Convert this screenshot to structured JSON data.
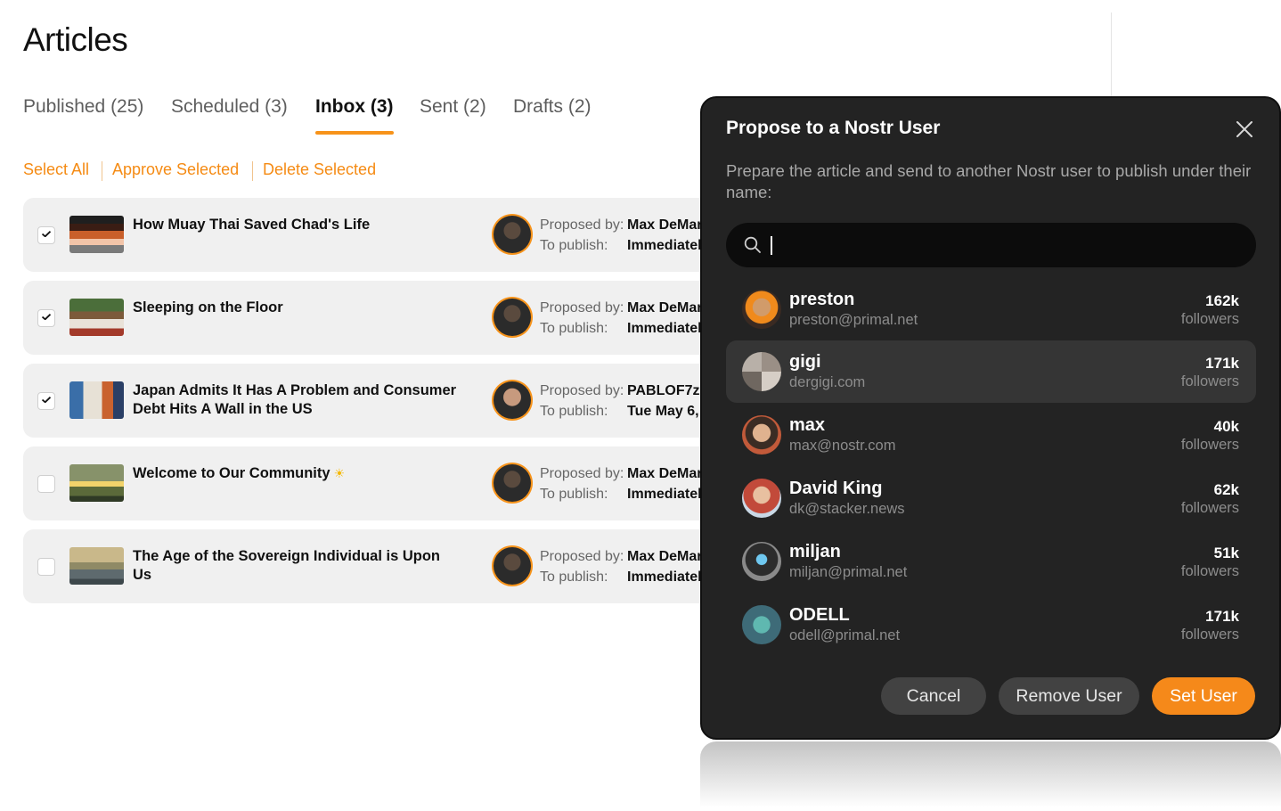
{
  "page": {
    "title": "Articles"
  },
  "tabs": [
    {
      "label": "Published (25)",
      "active": false
    },
    {
      "label": "Scheduled (3)",
      "active": false
    },
    {
      "label": "Inbox (3)",
      "active": true
    },
    {
      "label": "Sent (2)",
      "active": false
    },
    {
      "label": "Drafts (2)",
      "active": false
    }
  ],
  "bulk_actions": {
    "select_all": "Select All",
    "approve": "Approve Selected",
    "delete": "Delete Selected"
  },
  "articles": [
    {
      "title": "How Muay Thai Saved Chad's Life",
      "checked": true,
      "proposed_label": "Proposed by:",
      "proposed_by": "Max DeMar",
      "publish_label": "To publish:",
      "publish": "Immediatel"
    },
    {
      "title": "Sleeping on the Floor",
      "checked": true,
      "proposed_label": "Proposed by:",
      "proposed_by": "Max DeMar",
      "publish_label": "To publish:",
      "publish": "Immediatel"
    },
    {
      "title": "Japan Admits It Has A Problem and Consumer Debt Hits A Wall in the US",
      "checked": true,
      "proposed_label": "Proposed by:",
      "proposed_by": "PABLOF7z",
      "publish_label": "To publish:",
      "publish": "Tue May 6,"
    },
    {
      "title": "Welcome to Our Community",
      "checked": false,
      "proposed_label": "Proposed by:",
      "proposed_by": "Max DeMar",
      "publish_label": "To publish:",
      "publish": "Immediatel"
    },
    {
      "title": "The Age of the Sovereign Individual is Upon Us",
      "checked": false,
      "proposed_label": "Proposed by:",
      "proposed_by": "Max DeMar",
      "publish_label": "To publish:",
      "publish": "Immediatel"
    }
  ],
  "modal": {
    "title": "Propose to a Nostr User",
    "description": "Prepare the article and send to another Nostr user to publish under their name:",
    "search_value": "",
    "users": [
      {
        "name": "preston",
        "handle": "preston@primal.net",
        "count": "162k",
        "label": "followers",
        "highlighted": false
      },
      {
        "name": "gigi",
        "handle": "dergigi.com",
        "count": "171k",
        "label": "followers",
        "highlighted": true
      },
      {
        "name": "max",
        "handle": "max@nostr.com",
        "count": "40k",
        "label": "followers",
        "highlighted": false
      },
      {
        "name": "David King",
        "handle": "dk@stacker.news",
        "count": "62k",
        "label": "followers",
        "highlighted": false
      },
      {
        "name": "miljan",
        "handle": "miljan@primal.net",
        "count": "51k",
        "label": "followers",
        "highlighted": false
      },
      {
        "name": "ODELL",
        "handle": "odell@primal.net",
        "count": "171k",
        "label": "followers",
        "highlighted": false
      }
    ],
    "buttons": {
      "cancel": "Cancel",
      "remove": "Remove User",
      "set": "Set User"
    }
  },
  "colors": {
    "accent": "#f5891a",
    "modal_bg": "#232323",
    "row_bg": "#f0f0f0"
  },
  "icons": [
    "check-icon",
    "search-icon",
    "close-icon",
    "sun-emoji-icon"
  ]
}
